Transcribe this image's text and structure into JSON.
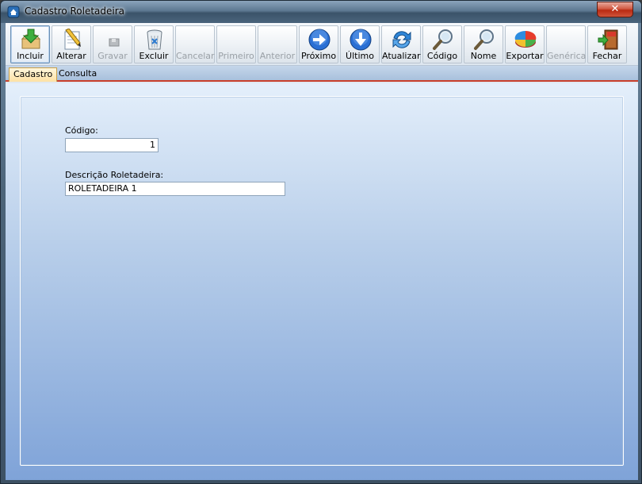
{
  "window": {
    "title": "Cadastro Roletadeira",
    "close_label": "✕"
  },
  "toolbar": {
    "buttons": [
      {
        "label": "Incluir",
        "icon": "add-download-icon",
        "enabled": true,
        "active": true
      },
      {
        "label": "Alterar",
        "icon": "pencil-document-icon",
        "enabled": true
      },
      {
        "label": "Gravar",
        "icon": "save-icon",
        "enabled": false
      },
      {
        "label": "Excluir",
        "icon": "trash-icon",
        "enabled": true
      },
      {
        "label": "Cancelar",
        "icon": "cancel-icon",
        "enabled": false
      },
      {
        "label": "Primeiro",
        "icon": "first-record-icon",
        "enabled": false
      },
      {
        "label": "Anterior",
        "icon": "previous-record-icon",
        "enabled": false
      },
      {
        "label": "Próximo",
        "icon": "arrow-right-icon",
        "enabled": true
      },
      {
        "label": "Último",
        "icon": "arrow-down-icon",
        "enabled": true
      },
      {
        "label": "Atualizar",
        "icon": "refresh-icon",
        "enabled": true
      },
      {
        "label": "Código",
        "icon": "search-code-icon",
        "enabled": true
      },
      {
        "label": "Nome",
        "icon": "search-name-icon",
        "enabled": true
      },
      {
        "label": "Exportar",
        "icon": "pie-chart-icon",
        "enabled": true
      },
      {
        "label": "Genérica",
        "icon": "generic-icon",
        "enabled": false
      },
      {
        "label": "Fechar",
        "icon": "exit-icon",
        "enabled": true
      }
    ]
  },
  "tabs": [
    {
      "label": "Cadastro",
      "active": true
    },
    {
      "label": "Consulta",
      "active": false
    }
  ],
  "form": {
    "codigo_label": "Código:",
    "codigo_value": "1",
    "descricao_label": "Descrição Roletadeira:",
    "descricao_value": "ROLETADEIRA 1"
  }
}
